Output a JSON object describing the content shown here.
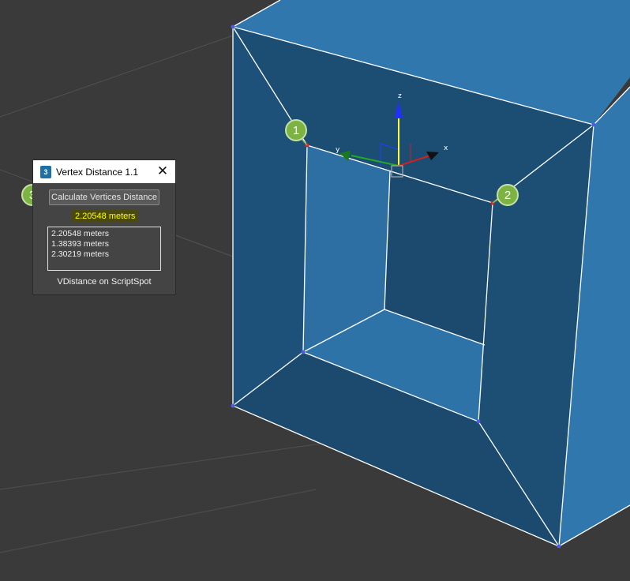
{
  "viewport": {
    "callouts": [
      "1",
      "2",
      "3"
    ],
    "gizmo": {
      "z_label": "z",
      "y_label": "y",
      "x_label": "x"
    },
    "colors": {
      "background": "#3a3a3a",
      "box_face": "#2f77ad",
      "box_inner": "#1c4d72",
      "callout": "#7cb342",
      "vertex": "#4e5ce6",
      "selected_vertex": "#e02020"
    }
  },
  "panel": {
    "app_icon_label": "3",
    "title": "Vertex Distance 1.1",
    "close_icon": "close-icon",
    "calculate_button": "Calculate Vertices Distance",
    "result": "2.20548 meters",
    "results_list": [
      "2.20548 meters",
      "1.38393 meters",
      "2.30219 meters"
    ],
    "footer": "VDistance on ScriptSpot",
    "colors": {
      "result_text": "#ffff00",
      "panel_bg": "#444444"
    }
  }
}
